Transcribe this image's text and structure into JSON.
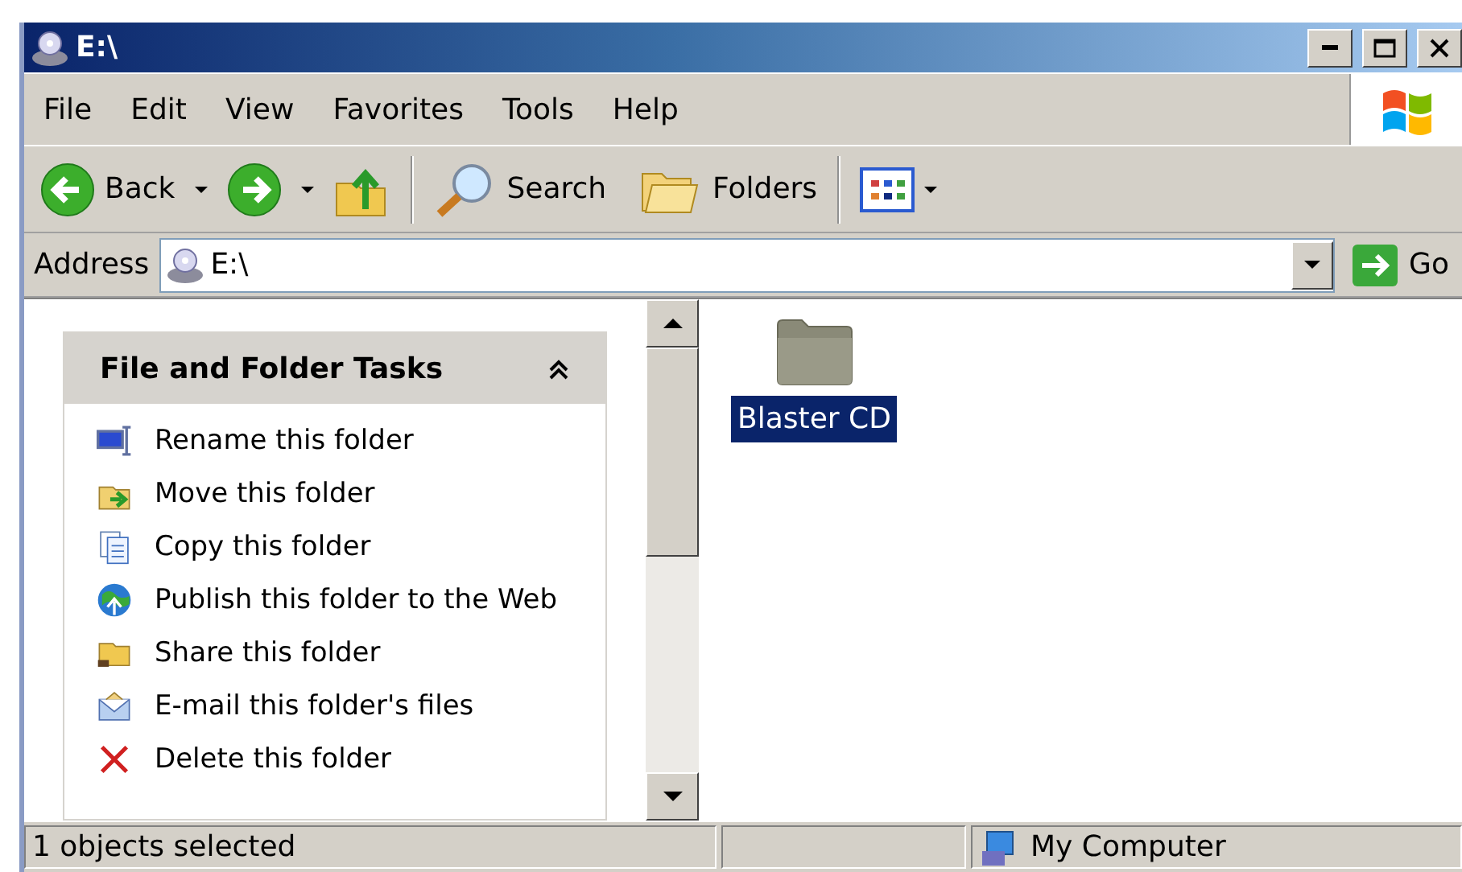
{
  "window": {
    "title": "E:\\"
  },
  "menu": [
    {
      "label": "File"
    },
    {
      "label": "Edit"
    },
    {
      "label": "View"
    },
    {
      "label": "Favorites"
    },
    {
      "label": "Tools"
    },
    {
      "label": "Help"
    }
  ],
  "toolbar": {
    "back": "Back",
    "search": "Search",
    "folders": "Folders"
  },
  "address": {
    "label": "Address",
    "value": "E:\\",
    "go": "Go"
  },
  "task_panel": {
    "title": "File and Folder Tasks",
    "expanded": true,
    "items": [
      {
        "kind": "rename",
        "label": "Rename this folder"
      },
      {
        "kind": "move",
        "label": "Move this folder"
      },
      {
        "kind": "copy",
        "label": "Copy this folder"
      },
      {
        "kind": "publish",
        "label": "Publish this folder to the Web"
      },
      {
        "kind": "share",
        "label": "Share this folder"
      },
      {
        "kind": "email",
        "label": "E-mail this folder's files"
      },
      {
        "kind": "delete",
        "label": "Delete this folder"
      }
    ]
  },
  "files": [
    {
      "name": "Blaster CD",
      "selected": true
    }
  ],
  "status_bar": {
    "message": "1 objects selected",
    "zone": "My Computer"
  }
}
